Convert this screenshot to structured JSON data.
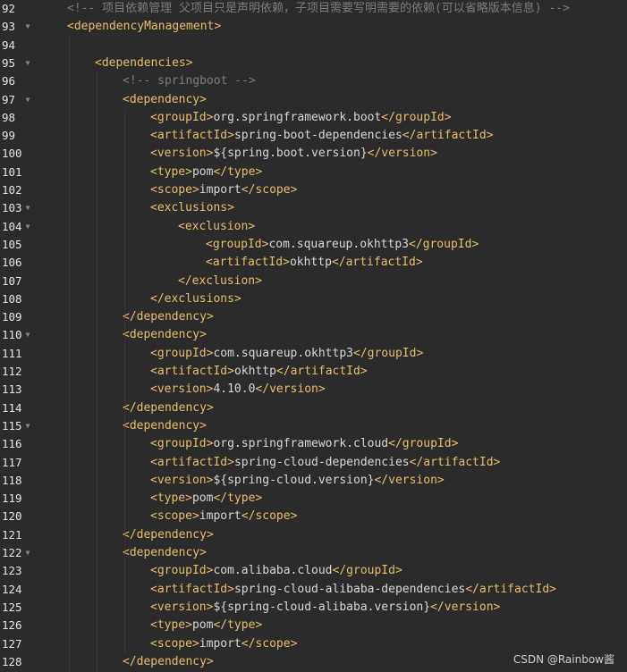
{
  "editor": {
    "lines": [
      {
        "n": "92",
        "fold": false,
        "indent": 1,
        "kind": "comment",
        "text": "<!-- 项目依赖管理 父项目只是声明依赖，子项目需要写明需要的依赖(可以省略版本信息) -->"
      },
      {
        "n": "93",
        "fold": true,
        "indent": 1,
        "kind": "open",
        "tag": "dependencyManagement"
      },
      {
        "n": "94",
        "fold": false,
        "indent": 0,
        "kind": "blank"
      },
      {
        "n": "95",
        "fold": true,
        "indent": 2,
        "kind": "open",
        "tag": "dependencies"
      },
      {
        "n": "96",
        "fold": false,
        "indent": 3,
        "kind": "comment",
        "text": "<!-- springboot -->"
      },
      {
        "n": "97",
        "fold": true,
        "indent": 3,
        "kind": "open",
        "tag": "dependency"
      },
      {
        "n": "98",
        "fold": false,
        "indent": 4,
        "kind": "elem",
        "tag": "groupId",
        "value": "org.springframework.boot"
      },
      {
        "n": "99",
        "fold": false,
        "indent": 4,
        "kind": "elem",
        "tag": "artifactId",
        "value": "spring-boot-dependencies"
      },
      {
        "n": "100",
        "fold": false,
        "indent": 4,
        "kind": "elem",
        "tag": "version",
        "value": "${spring.boot.version}"
      },
      {
        "n": "101",
        "fold": false,
        "indent": 4,
        "kind": "elem",
        "tag": "type",
        "value": "pom"
      },
      {
        "n": "102",
        "fold": false,
        "indent": 4,
        "kind": "elem",
        "tag": "scope",
        "value": "import"
      },
      {
        "n": "103",
        "fold": true,
        "indent": 4,
        "kind": "open",
        "tag": "exclusions"
      },
      {
        "n": "104",
        "fold": true,
        "indent": 5,
        "kind": "open",
        "tag": "exclusion"
      },
      {
        "n": "105",
        "fold": false,
        "indent": 6,
        "kind": "elem",
        "tag": "groupId",
        "value": "com.squareup.okhttp3"
      },
      {
        "n": "106",
        "fold": false,
        "indent": 6,
        "kind": "elem",
        "tag": "artifactId",
        "value": "okhttp"
      },
      {
        "n": "107",
        "fold": false,
        "indent": 5,
        "kind": "close",
        "tag": "exclusion"
      },
      {
        "n": "108",
        "fold": false,
        "indent": 4,
        "kind": "close",
        "tag": "exclusions"
      },
      {
        "n": "109",
        "fold": false,
        "indent": 3,
        "kind": "close",
        "tag": "dependency"
      },
      {
        "n": "110",
        "fold": true,
        "indent": 3,
        "kind": "open",
        "tag": "dependency"
      },
      {
        "n": "111",
        "fold": false,
        "indent": 4,
        "kind": "elem",
        "tag": "groupId",
        "value": "com.squareup.okhttp3"
      },
      {
        "n": "112",
        "fold": false,
        "indent": 4,
        "kind": "elem",
        "tag": "artifactId",
        "value": "okhttp"
      },
      {
        "n": "113",
        "fold": false,
        "indent": 4,
        "kind": "elem",
        "tag": "version",
        "value": "4.10.0"
      },
      {
        "n": "114",
        "fold": false,
        "indent": 3,
        "kind": "close",
        "tag": "dependency"
      },
      {
        "n": "115",
        "fold": true,
        "indent": 3,
        "kind": "open",
        "tag": "dependency"
      },
      {
        "n": "116",
        "fold": false,
        "indent": 4,
        "kind": "elem",
        "tag": "groupId",
        "value": "org.springframework.cloud"
      },
      {
        "n": "117",
        "fold": false,
        "indent": 4,
        "kind": "elem",
        "tag": "artifactId",
        "value": "spring-cloud-dependencies"
      },
      {
        "n": "118",
        "fold": false,
        "indent": 4,
        "kind": "elem",
        "tag": "version",
        "value": "${spring-cloud.version}"
      },
      {
        "n": "119",
        "fold": false,
        "indent": 4,
        "kind": "elem",
        "tag": "type",
        "value": "pom"
      },
      {
        "n": "120",
        "fold": false,
        "indent": 4,
        "kind": "elem",
        "tag": "scope",
        "value": "import"
      },
      {
        "n": "121",
        "fold": false,
        "indent": 3,
        "kind": "close",
        "tag": "dependency"
      },
      {
        "n": "122",
        "fold": true,
        "indent": 3,
        "kind": "open",
        "tag": "dependency"
      },
      {
        "n": "123",
        "fold": false,
        "indent": 4,
        "kind": "elem",
        "tag": "groupId",
        "value": "com.alibaba.cloud"
      },
      {
        "n": "124",
        "fold": false,
        "indent": 4,
        "kind": "elem",
        "tag": "artifactId",
        "value": "spring-cloud-alibaba-dependencies"
      },
      {
        "n": "125",
        "fold": false,
        "indent": 4,
        "kind": "elem",
        "tag": "version",
        "value": "${spring-cloud-alibaba.version}"
      },
      {
        "n": "126",
        "fold": false,
        "indent": 4,
        "kind": "elem",
        "tag": "type",
        "value": "pom"
      },
      {
        "n": "127",
        "fold": false,
        "indent": 4,
        "kind": "elem",
        "tag": "scope",
        "value": "import"
      },
      {
        "n": "128",
        "fold": false,
        "indent": 3,
        "kind": "close",
        "tag": "dependency"
      }
    ]
  },
  "colors": {
    "background": "#2b2b2b",
    "tag": "#e8bf6a",
    "text": "#d8d8d8",
    "comment": "#7c7c7c",
    "line_number": "#e6e6e6"
  },
  "watermark": "CSDN @Rainbow酱"
}
